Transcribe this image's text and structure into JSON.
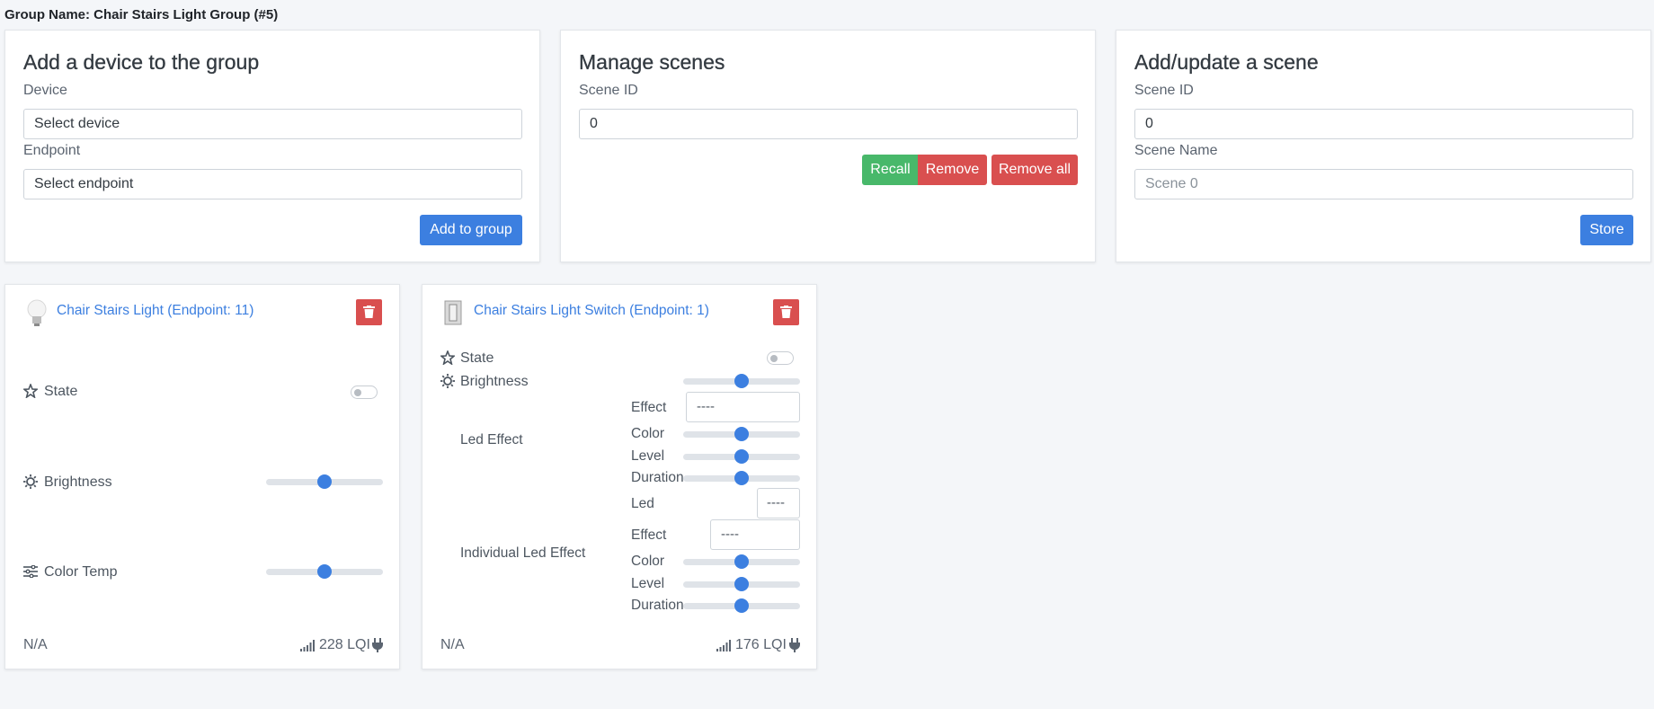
{
  "group": {
    "title": "Group Name: Chair Stairs Light Group (#5)"
  },
  "add_device": {
    "heading": "Add a device to the group",
    "device_label": "Device",
    "device_value": "Select device",
    "endpoint_label": "Endpoint",
    "endpoint_value": "Select endpoint",
    "add_button": "Add to group"
  },
  "manage_scenes": {
    "heading": "Manage scenes",
    "scene_id_label": "Scene ID",
    "scene_id_value": "0",
    "recall_button": "Recall",
    "remove_button": "Remove",
    "remove_all_button": "Remove all"
  },
  "add_scene": {
    "heading": "Add/update a scene",
    "scene_id_label": "Scene ID",
    "scene_id_value": "0",
    "scene_name_label": "Scene Name",
    "scene_name_placeholder": "Scene 0",
    "store_button": "Store"
  },
  "device1": {
    "title": "Chair Stairs Light (Endpoint: 11)",
    "state_label": "State",
    "state_on": false,
    "brightness_label": "Brightness",
    "brightness_value": 0.5,
    "color_temp_label": "Color Temp",
    "color_temp_value": 0.5,
    "last_seen": "N/A",
    "lqi": "228 LQI"
  },
  "device2": {
    "title": "Chair Stairs Light Switch (Endpoint: 1)",
    "state_label": "State",
    "state_on": false,
    "brightness_label": "Brightness",
    "brightness_value": 0.5,
    "led_effect": {
      "label": "Led Effect",
      "effect_label": "Effect",
      "effect_value": "----",
      "color_label": "Color",
      "color_value": 0.5,
      "level_label": "Level",
      "level_value": 0.5,
      "duration_label": "Duration",
      "duration_value": 0.5
    },
    "individual_led_effect": {
      "label": "Individual Led Effect",
      "led_label": "Led",
      "led_value": "----",
      "effect_label": "Effect",
      "effect_value": "----",
      "color_label": "Color",
      "color_value": 0.5,
      "level_label": "Level",
      "level_value": 0.5,
      "duration_label": "Duration",
      "duration_value": 0.5
    },
    "last_seen": "N/A",
    "lqi": "176 LQI"
  },
  "colors": {
    "primary": "#3c7fe0",
    "success": "#48b86a",
    "danger": "#d94f4f"
  }
}
